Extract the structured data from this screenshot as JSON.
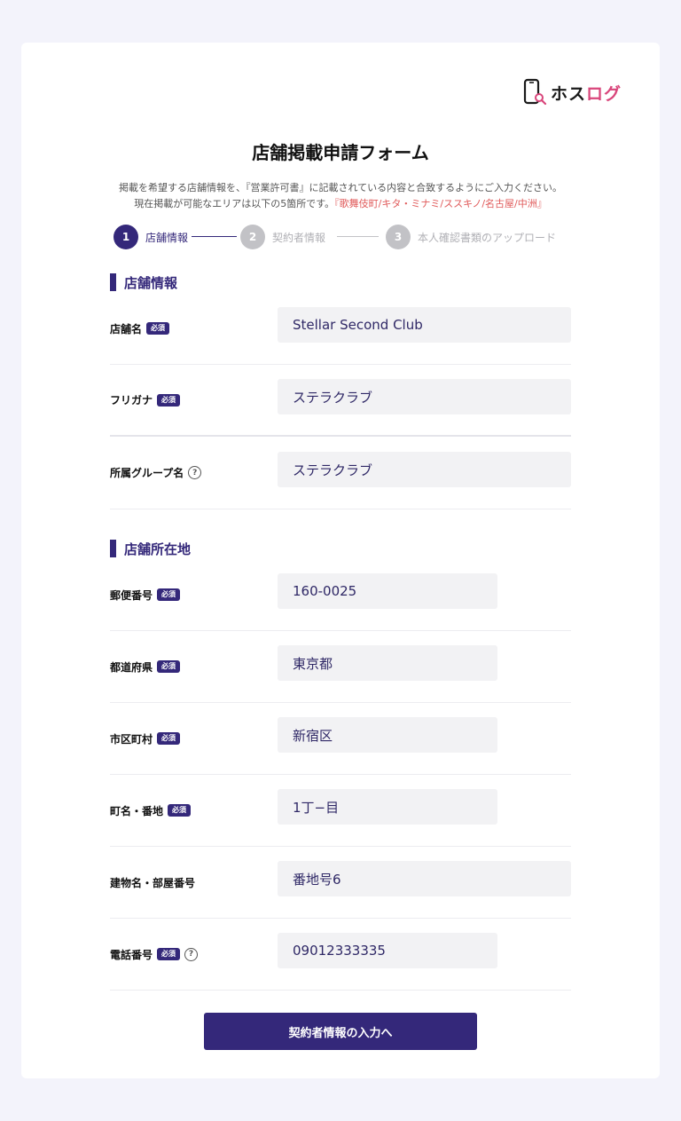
{
  "logo": {
    "text_dark": "ホス",
    "text_pink": "ログ",
    "icon": "phone-search-icon"
  },
  "title": "店舗掲載申請フォーム",
  "description": {
    "line1": "掲載を希望する店舗情報を、『営業許可書』に記載されている内容と合致するようにご入力ください。",
    "line2_prefix": "現在掲載が可能なエリアは以下の5箇所です。",
    "line2_areas": "『歌舞伎町/キタ・ミナミ/ススキノ/名古屋/中洲』"
  },
  "steps": [
    {
      "number": "1",
      "label": "店舗情報",
      "active": true
    },
    {
      "number": "2",
      "label": "契約者情報",
      "active": false
    },
    {
      "number": "3",
      "label": "本人確認書類のアップロード",
      "active": false
    }
  ],
  "required_badge": "必須",
  "help_glyph": "?",
  "sections": {
    "store_info": {
      "title": "店舗情報",
      "fields": [
        {
          "label": "店舗名",
          "value": "Stellar Second Club"
        },
        {
          "label": "フリガナ",
          "value": "ステラクラブ"
        },
        {
          "label": "所属グループ名",
          "value": "ステラクラブ"
        }
      ]
    },
    "store_address": {
      "title": "店舗所在地",
      "fields": [
        {
          "label": "郵便番号",
          "value": "160-0025"
        },
        {
          "label": "都道府県",
          "value": "東京都"
        },
        {
          "label": "市区町村",
          "value": "新宿区"
        },
        {
          "label": "町名・番地",
          "value": "1丁−目"
        },
        {
          "label": "建物名・部屋番号",
          "value": "番地号6"
        },
        {
          "label": "電話番号",
          "value": "09012333335"
        }
      ]
    }
  },
  "submit_label": "契約者情報の入力へ",
  "colors": {
    "primary": "#34287a",
    "accent_pink": "#d9467b",
    "area_red": "#e05a5a",
    "inactive_step": "#c2c2c6",
    "background": "#f3f3fb"
  }
}
